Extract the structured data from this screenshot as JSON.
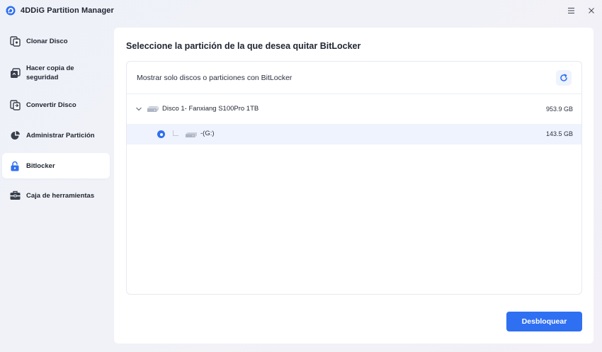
{
  "app": {
    "title": "4DDiG Partition Manager",
    "logo_icon": "4ddig-logo-icon",
    "accent_color": "#2f6ff2"
  },
  "titlebar": {
    "menu_icon": "hamburger-menu-icon",
    "close_icon": "close-icon"
  },
  "sidebar": {
    "items": [
      {
        "label": "Clonar Disco",
        "icon": "clone-disk-icon",
        "active": false
      },
      {
        "label": "Hacer copia de seguridad",
        "icon": "backup-icon",
        "active": false
      },
      {
        "label": "Convertir Disco",
        "icon": "convert-disk-icon",
        "active": false
      },
      {
        "label": "Administrar Partición",
        "icon": "pie-chart-icon",
        "active": false
      },
      {
        "label": "Bitlocker",
        "icon": "lock-icon",
        "active": true
      },
      {
        "label": "Caja de herramientas",
        "icon": "toolbox-icon",
        "active": false
      }
    ]
  },
  "main": {
    "title": "Seleccione la partición de la que desea quitar BitLocker",
    "filter_label": "Mostrar solo discos o particiones con BitLocker",
    "refresh_icon": "refresh-icon",
    "disk": {
      "name": "Disco 1- Fanxiang S100Pro 1TB",
      "size": "953.9 GB",
      "expanded": true,
      "partitions": [
        {
          "name": "-(G:)",
          "size": "143.5 GB",
          "selected": true
        }
      ]
    },
    "unlock_button": "Desbloquear"
  }
}
